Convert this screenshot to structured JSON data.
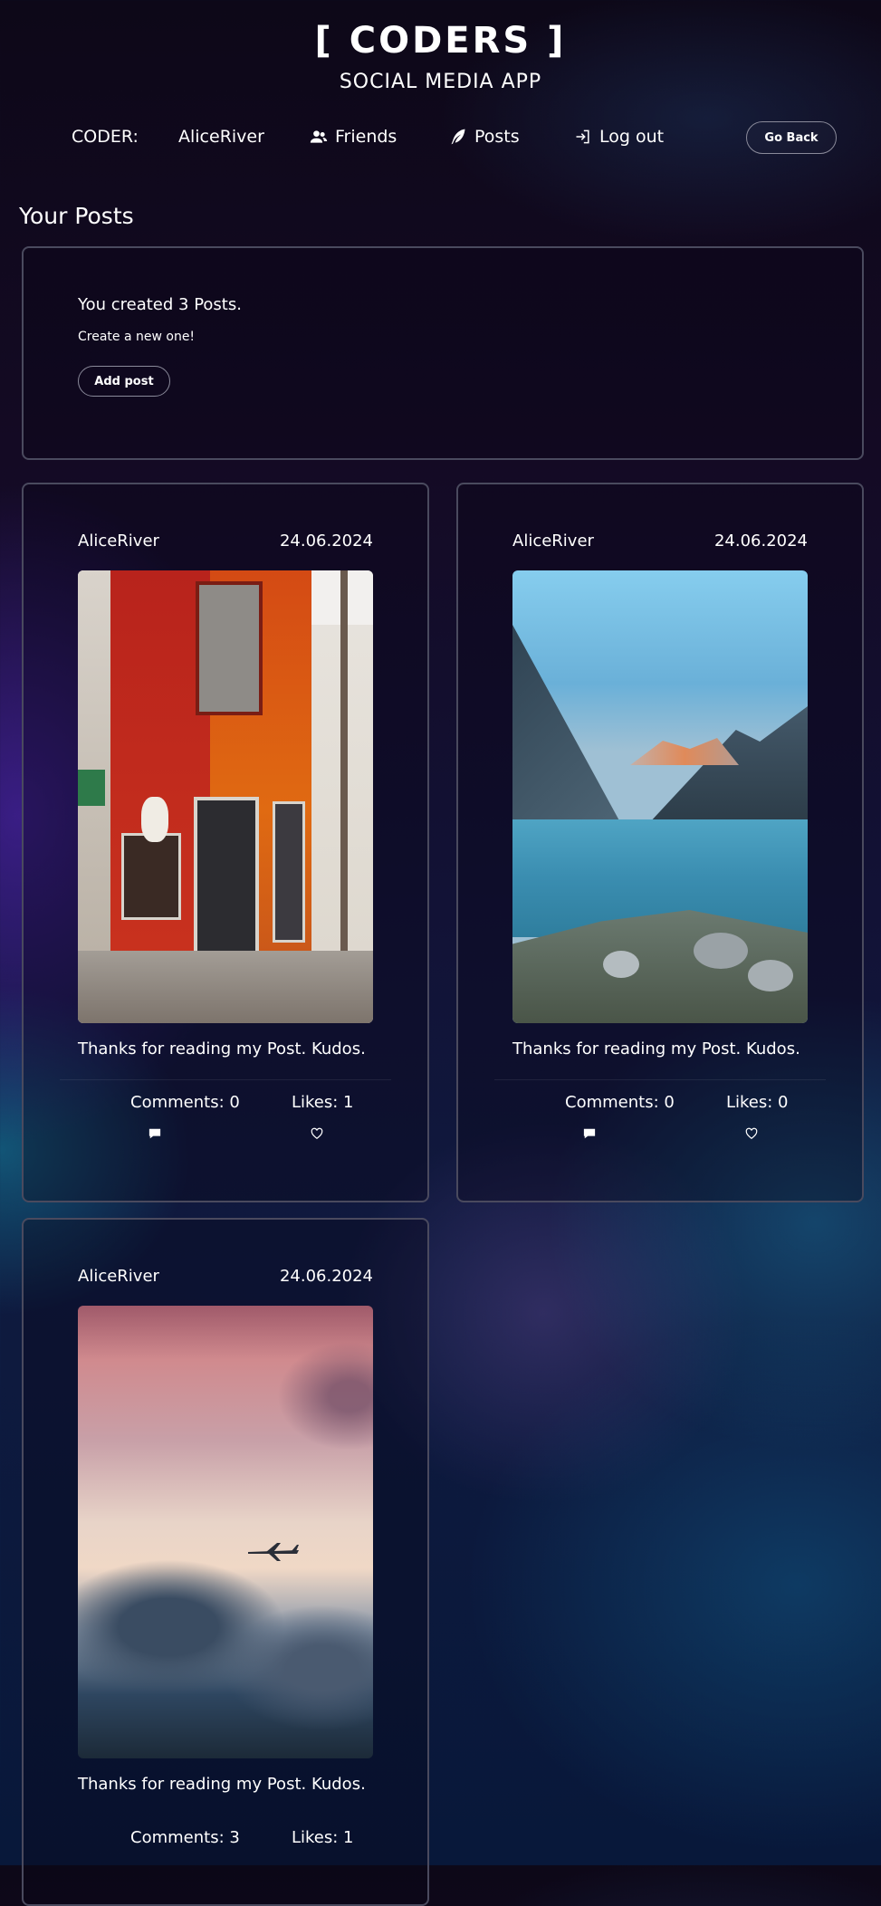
{
  "header": {
    "title": "[ CODERS ]",
    "subtitle": "SOCIAL MEDIA APP"
  },
  "nav": {
    "coder_label": "CODER:",
    "username": "AliceRiver",
    "friends_label": "Friends",
    "posts_label": "Posts",
    "logout_label": "Log out",
    "go_back_label": "Go Back"
  },
  "section_title": "Your Posts",
  "summary": {
    "title": "You created 3 Posts.",
    "subtitle": "Create a new one!",
    "add_label": "Add post"
  },
  "posts": [
    {
      "author": "AliceRiver",
      "date": "24.06.2024",
      "caption": "Thanks for reading my Post. Kudos.",
      "comments": "Comments: 0",
      "likes": "Likes: 1",
      "liked": false,
      "image": "red-corner-building-photo"
    },
    {
      "author": "AliceRiver",
      "date": "24.06.2024",
      "caption": "Thanks for reading my Post. Kudos.",
      "comments": "Comments: 0",
      "likes": "Likes: 0",
      "liked": false,
      "image": "mountain-lake-photo"
    },
    {
      "author": "AliceRiver",
      "date": "24.06.2024",
      "caption": "Thanks for reading my Post. Kudos.",
      "comments": "Comments: 3",
      "likes": "Likes: 1",
      "liked": true,
      "image": "airplane-in-clouds-photo"
    }
  ],
  "colors": {
    "background": "#0d0818",
    "border": "#4a4a5e",
    "liked_heart": "#e53935"
  }
}
